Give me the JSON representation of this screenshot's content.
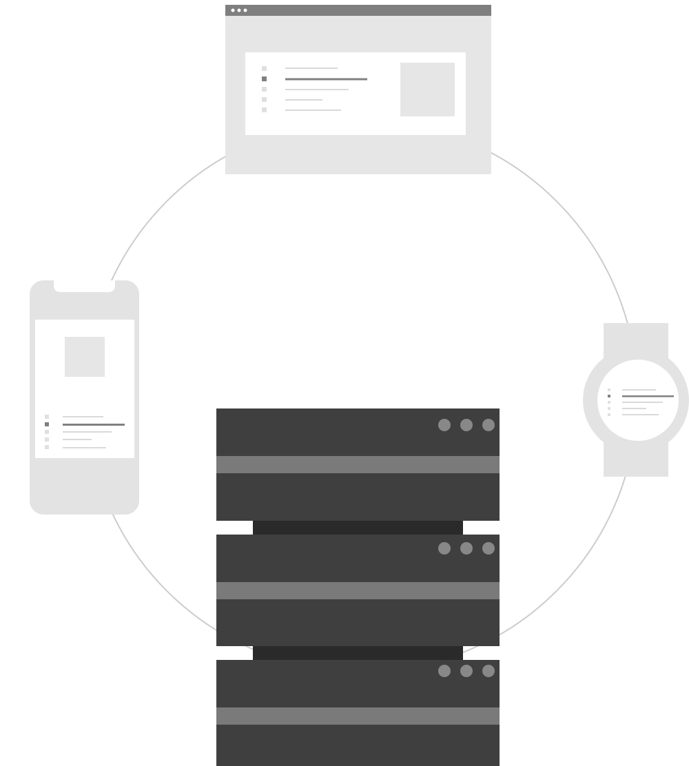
{
  "diagram": {
    "kind": "multi-device-server-illustration",
    "text_labels": [],
    "devices": [
      {
        "id": "browser-window",
        "icon": "browser-window-icon"
      },
      {
        "id": "smartphone",
        "icon": "smartphone-icon"
      },
      {
        "id": "smartwatch",
        "icon": "smartwatch-icon"
      },
      {
        "id": "server-rack",
        "icon": "server-rack-icon"
      }
    ],
    "server_rack": {
      "unit_count": 3,
      "leds_per_unit": 3
    },
    "colors": {
      "background": "#ffffff",
      "ring": "#cccccc",
      "device_light": "#e6e6e6",
      "device_frame": "#e3e3e3",
      "screen": "#ffffff",
      "placeholder_dark": "#808080",
      "placeholder_light": "#d9d9d9",
      "browser_titlebar": "#7f7f7f",
      "server_body": "#3f3f3f",
      "server_stripe": "#7a7a7a",
      "server_connector": "#2a2a2a",
      "server_led": "#888888"
    }
  }
}
